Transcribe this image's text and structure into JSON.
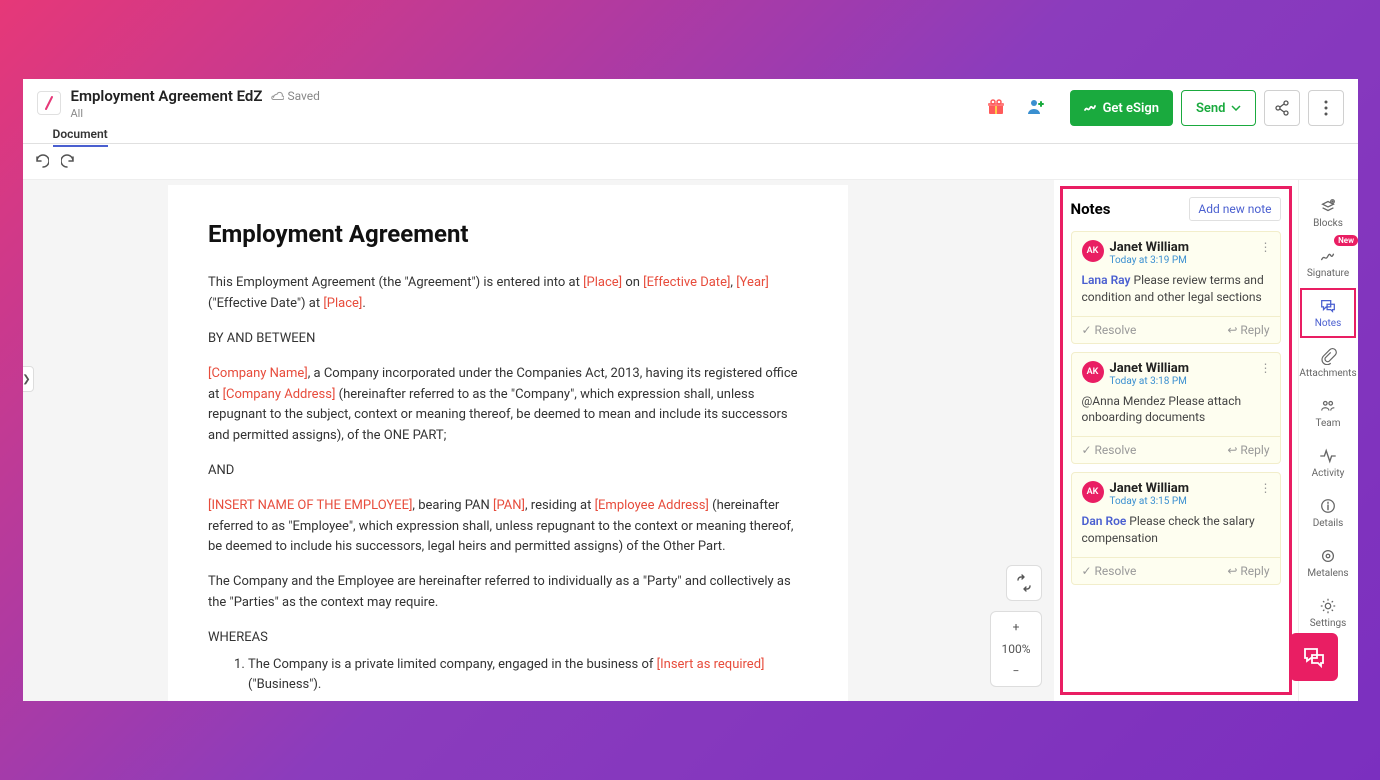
{
  "header": {
    "title": "Employment Agreement EdZ",
    "saved": "Saved",
    "subtitle": "All",
    "tab": "Document",
    "esign": "Get eSign",
    "send": "Send"
  },
  "doc": {
    "heading": "Employment Agreement",
    "p1a": "This Employment Agreement (the \"Agreement\") is entered into at ",
    "ph_place": "[Place]",
    "p1b": " on ",
    "ph_eff": "[Effective Date]",
    "comma": ", ",
    "ph_year": "[Year]",
    "p1c": " (\"Effective Date\") at ",
    "ph_place2": "[Place]",
    "period": ".",
    "p2": "BY AND BETWEEN",
    "ph_co": "[Company Name]",
    "p3a": ", a Company incorporated under the Companies Act, 2013, having its registered office at ",
    "ph_addr": "[Company Address]",
    "p3b": " (hereinafter referred to as the \"Company\", which expression shall, unless repugnant to the subject, context or meaning thereof, be deemed to mean and include its successors and permitted assigns), of the ONE PART;",
    "p4": "AND",
    "ph_emp": "[INSERT NAME OF THE EMPLOYEE]",
    "p5a": ", bearing PAN ",
    "ph_pan": "[PAN]",
    "p5b": ", residing at ",
    "ph_eaddr": "[Employee Address]",
    "p5c": " (hereinafter referred to as \"Employee\", which expression shall, unless repugnant to the context or meaning thereof, be deemed to include his successors, legal heirs and permitted assigns) of the Other Part.",
    "p6": "The Company and the Employee are hereinafter referred to individually as a \"Party\" and collectively as the \"Parties\" as the context may require.",
    "p7": "WHEREAS",
    "li1a": "The Company is a private limited company, engaged in the business of ",
    "ph_ins": "[Insert as required]",
    "li1b": " (\"Business\")."
  },
  "zoom": "100%",
  "notes": {
    "title": "Notes",
    "add": "Add new note",
    "items": [
      {
        "avatar": "AK",
        "author": "Janet William",
        "time": "Today at 3:19 PM",
        "mention": "Lana Ray",
        "body": "Please review terms and condition and other legal sections"
      },
      {
        "avatar": "AK",
        "author": "Janet William",
        "time": "Today at 3:18 PM",
        "mention": "",
        "body": "@Anna Mendez Please attach onboarding documents"
      },
      {
        "avatar": "AK",
        "author": "Janet William",
        "time": "Today at 3:15 PM",
        "mention": "Dan Roe",
        "body": "Please check the salary compensation"
      }
    ],
    "resolve": "Resolve",
    "reply": "Reply"
  },
  "sidebar": {
    "blocks": "Blocks",
    "signature": "Signature",
    "notes": "Notes",
    "attachments": "Attachments",
    "team": "Team",
    "activity": "Activity",
    "details": "Details",
    "metalens": "Metalens",
    "settings": "Settings",
    "new": "New"
  }
}
